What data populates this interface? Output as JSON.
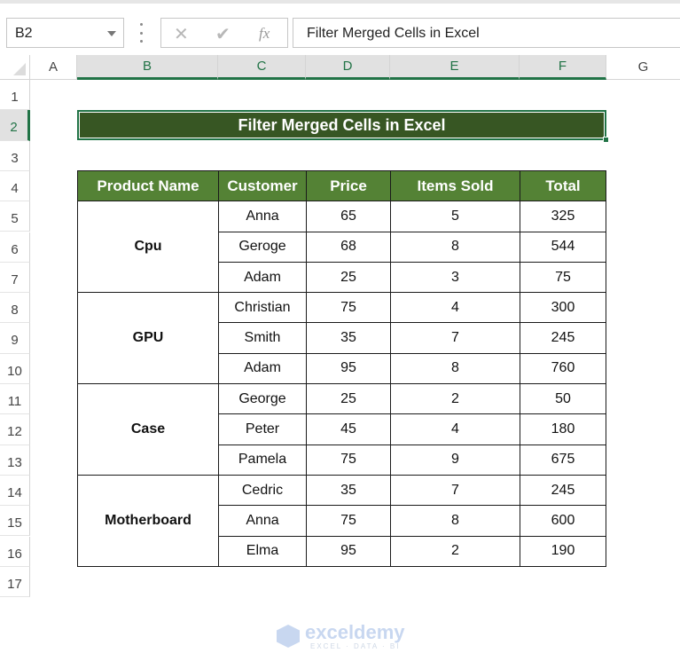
{
  "formula_bar": {
    "name_box": "B2",
    "cancel_icon": "✕",
    "enter_icon": "✔",
    "fx_icon": "fx",
    "formula": "Filter Merged Cells in Excel"
  },
  "columns": [
    "A",
    "B",
    "C",
    "D",
    "E",
    "F",
    "G"
  ],
  "rows": [
    "1",
    "2",
    "3",
    "4",
    "5",
    "6",
    "7",
    "8",
    "9",
    "10",
    "11",
    "12",
    "13",
    "14",
    "15",
    "16",
    "17"
  ],
  "sheet": {
    "title": "Filter Merged Cells in Excel",
    "headers": [
      "Product Name",
      "Customer",
      "Price",
      "Items Sold",
      "Total"
    ],
    "groups": [
      {
        "product": "Cpu",
        "rows": [
          [
            "Anna",
            "65",
            "5",
            "325"
          ],
          [
            "Geroge",
            "68",
            "8",
            "544"
          ],
          [
            "Adam",
            "25",
            "3",
            "75"
          ]
        ]
      },
      {
        "product": "GPU",
        "rows": [
          [
            "Christian",
            "75",
            "4",
            "300"
          ],
          [
            "Smith",
            "35",
            "7",
            "245"
          ],
          [
            "Adam",
            "95",
            "8",
            "760"
          ]
        ]
      },
      {
        "product": "Case",
        "rows": [
          [
            "George",
            "25",
            "2",
            "50"
          ],
          [
            "Peter",
            "45",
            "4",
            "180"
          ],
          [
            "Pamela",
            "75",
            "9",
            "675"
          ]
        ]
      },
      {
        "product": "Motherboard",
        "rows": [
          [
            "Cedric",
            "35",
            "7",
            "245"
          ],
          [
            "Anna",
            "75",
            "8",
            "600"
          ],
          [
            "Elma",
            "95",
            "2",
            "190"
          ]
        ]
      }
    ]
  },
  "watermark": {
    "name": "exceldemy",
    "tagline": "EXCEL · DATA · BI"
  },
  "colors": {
    "header_green": "#548235",
    "title_green": "#375623",
    "accent": "#217346"
  }
}
